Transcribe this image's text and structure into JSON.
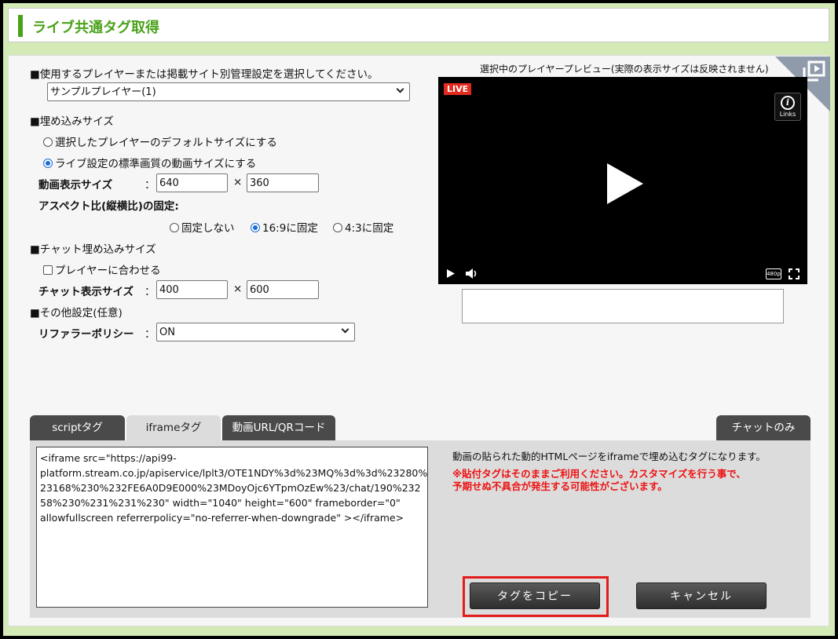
{
  "header": {
    "title": "ライブ共通タグ取得"
  },
  "settings": {
    "player_section_label": "■使用するプレイヤーまたは掲載サイト別管理設定を選択してください。",
    "player_select": "サンプルプレイヤー(1)",
    "embed_size_label": "■埋め込みサイズ",
    "radio_default_size": "選択したプレイヤーのデフォルトサイズにする",
    "radio_live_size": "ライブ設定の標準画質の動画サイズにする",
    "video_size_label": "動画表示サイズ",
    "colon": "：",
    "times": "×",
    "video_width": "640",
    "video_height": "360",
    "aspect_label": "アスペクト比(縦横比)の固定:",
    "aspect_none": "固定しない",
    "aspect_169": "16:9に固定",
    "aspect_43": "4:3に固定",
    "chat_section_label": "■チャット埋め込みサイズ",
    "chat_fit_player": "プレイヤーに合わせる",
    "chat_size_label": "チャット表示サイズ",
    "chat_width": "400",
    "chat_height": "600",
    "other_section_label": "■その他設定(任意)",
    "referrer_label": "リファラーポリシー",
    "referrer_select": "ON"
  },
  "preview": {
    "caption": "選択中のプレイヤープレビュー(実際の表示サイズは反映されません)",
    "live_badge": "LIVE",
    "links_label": "Links",
    "quality_badge": "480p"
  },
  "tabs": [
    {
      "label": "scriptタグ"
    },
    {
      "label": "iframeタグ"
    },
    {
      "label": "動画URL/QRコード"
    },
    {
      "label": "チャットのみ"
    }
  ],
  "tag_panel": {
    "code": "<iframe src=\"https://api99-\nplatform.stream.co.jp/apiservice/lplt3/OTE1NDY%3d%23MQ%3d%3d%23280%\n23168%230%232FE6A0D9E000%23MDoyOjc6YTpmOzEw%23/chat/190%232\n58%230%231%231%230\" width=\"1040\" height=\"600\" frameborder=\"0\"\nallowfullscreen referrerpolicy=\"no-referrer-when-downgrade\" ></iframe>",
    "info_text": "動画の貼られた動的HTMLページをiframeで埋め込むタグになります。",
    "warning_text": "※貼付タグはそのままご利用ください。カスタマイズを行う事で、\n予期せぬ不具合が発生する可能性がございます。",
    "copy_button": "タグをコピー",
    "cancel_button": "キャンセル"
  },
  "colors": {
    "brand_green": "#4aa21a",
    "warning_red": "#e11111",
    "highlight_red": "#e31b1b"
  }
}
